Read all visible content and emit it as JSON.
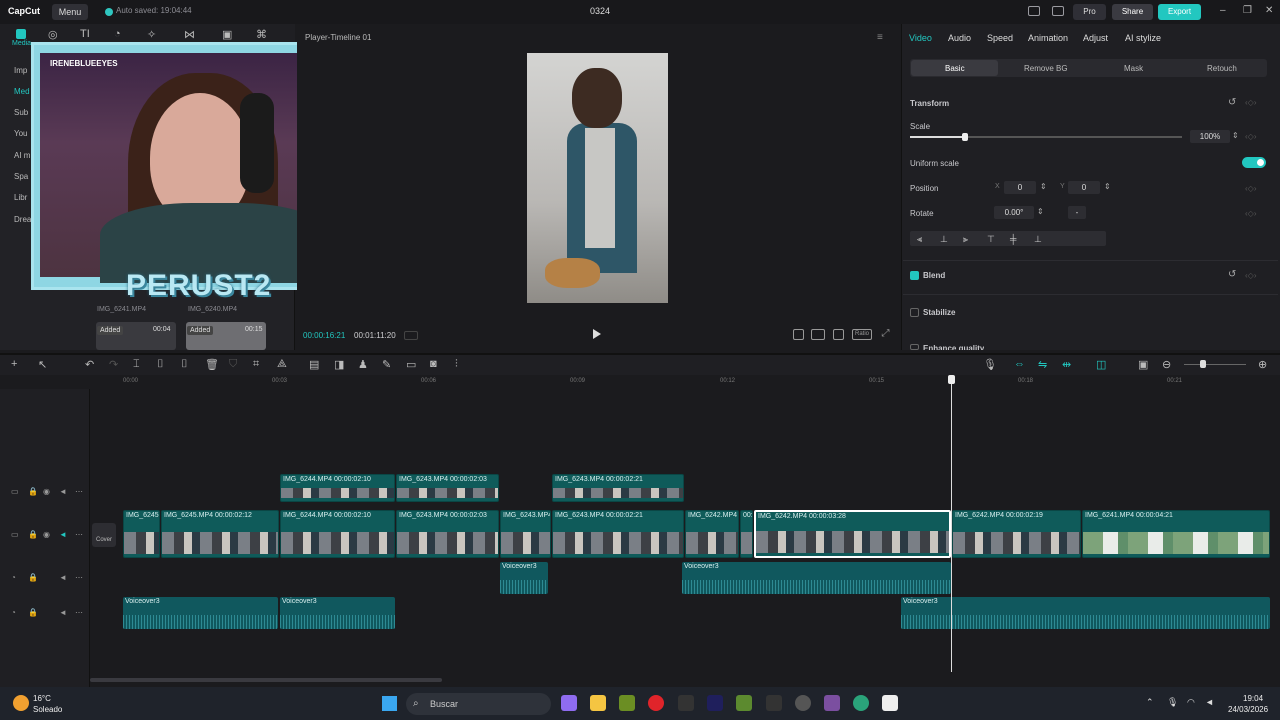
{
  "titlebar": {
    "logo": "CapCut",
    "menu": "Menu",
    "autosave": "Auto saved: 19:04:44",
    "project": "0324",
    "pro": "Pro",
    "share": "Share",
    "export": "Export"
  },
  "media": {
    "tabs": [
      "Media"
    ],
    "sidebar": [
      "Imp",
      "Med",
      "Sub",
      "You",
      "AI m",
      "Spa",
      "Libr",
      "Drea"
    ],
    "clips": [
      {
        "name": "IMG_6241.MP4"
      },
      {
        "name": "IMG_6240.MP4"
      }
    ],
    "added": "Added",
    "durations": [
      "00:04",
      "00:15"
    ]
  },
  "webcam": {
    "handle": "IRENEBLUEEYES",
    "overlay": "PERUST2"
  },
  "player": {
    "title": "Player-Timeline 01",
    "current": "00:00:16:21",
    "total": "00:01:11:20",
    "ratio": "Ratio"
  },
  "props": {
    "tabs": [
      "Video",
      "Audio",
      "Speed",
      "Animation",
      "Adjust",
      "AI stylize"
    ],
    "subtabs": [
      "Basic",
      "Remove BG",
      "Mask",
      "Retouch"
    ],
    "transform": "Transform",
    "scale": "Scale",
    "scale_value": "100%",
    "uniform": "Uniform scale",
    "position": "Position",
    "pos_x_label": "X",
    "pos_x": "0",
    "pos_y_label": "Y",
    "pos_y": "0",
    "rotate": "Rotate",
    "rotate_value": "0.00°",
    "rotate_extra": "-",
    "blend": "Blend",
    "stabilize": "Stabilize",
    "enhance": "Enhance quality"
  },
  "timeline": {
    "ticks": [
      "00:00",
      "00:03",
      "00:06",
      "00:09",
      "00:12",
      "00:15",
      "00:18",
      "00:21"
    ],
    "cover": "Cover",
    "overlay_clips": [
      {
        "label": "IMG_6244.MP4   00:00:02:10"
      },
      {
        "label": "IMG_6243.MP4   00:00:02:03"
      },
      {
        "label": "IMG_6243.MP4   00:00:02:21"
      }
    ],
    "main_clips": [
      {
        "label": "IMG_6245."
      },
      {
        "label": "IMG_6245.MP4   00:00:02:12"
      },
      {
        "label": "IMG_6244.MP4   00:00:02:10"
      },
      {
        "label": "IMG_6243.MP4   00:00:02:03"
      },
      {
        "label": "IMG_6243.MP4"
      },
      {
        "label": "IMG_6243.MP4   00:00:02:21"
      },
      {
        "label": "IMG_6242.MP4"
      },
      {
        "label": "00:"
      },
      {
        "label": "IMG_6242.MP4   00:00:03:28"
      },
      {
        "label": "IMG_6242.MP4   00:00:02:19"
      },
      {
        "label": "IMG_6241.MP4   00:00:04:21"
      }
    ],
    "voiceover": "Voiceover3"
  },
  "taskbar": {
    "temp": "16°C",
    "weather": "Soleado",
    "search": "Buscar",
    "time": "19:04",
    "date": "24/03/2026"
  }
}
